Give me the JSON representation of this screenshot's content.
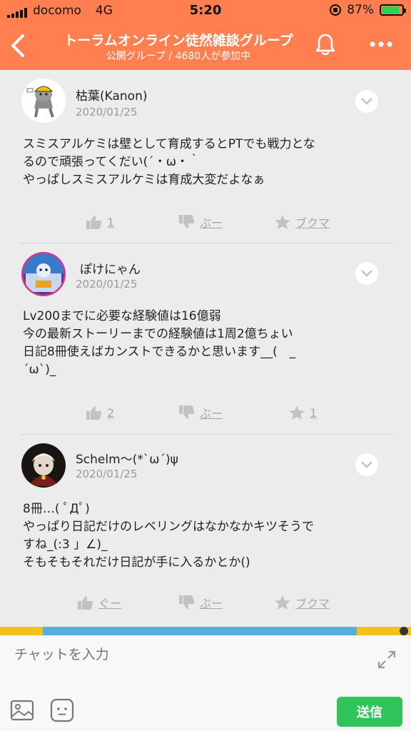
{
  "status_bar": {
    "carrier": "docomo",
    "network": "4G",
    "time": "5:20",
    "battery": "87%",
    "battery_level": 0.87
  },
  "header": {
    "title": "トーラムオンライン徒然雑談グループ",
    "subtitle": "公開グループ / 4680人が参加中"
  },
  "posts": [
    {
      "author": "枯葉(Kanon)",
      "date": "2020/01/25",
      "lines": [
        "スミスアルケミは壁として育成するとPTでも戦力とな",
        "るので頑張ってくだい(´・ω・｀",
        "やっぱしスミスアルケミは育成大変だよなぁ"
      ],
      "like": "1",
      "dislike": "ぶー",
      "bookmark": "ブクマ"
    },
    {
      "author": "ぽけにゃん",
      "date": "2020/01/25",
      "lines": [
        "Lv200までに必要な経験値は16億弱",
        "今の最新ストーリーまでの経験値は1周2億ちょい",
        "日記8冊使えばカンストできるかと思います__(　_",
        "´ω`)_"
      ],
      "like": "2",
      "dislike": "ぶー",
      "bookmark": "1"
    },
    {
      "author": "Schelm〜(*`ω´)ψ",
      "date": "2020/01/25",
      "lines": [
        "8冊…( ﾟДﾟ)",
        "やっぱり日記だけのレベリングはなかなかキツそうで",
        "すね_(:3 」∠)_",
        "そもそもそれだけ日記が手に入るかとか()"
      ],
      "like": "ぐー",
      "dislike": "ぶー",
      "bookmark": "ブクマ"
    }
  ],
  "composer": {
    "placeholder": "チャットを入力",
    "send_label": "送信"
  },
  "colors": {
    "header": "#ff7f50",
    "send": "#31c45a",
    "battery": "#2bd24b"
  },
  "icons": [
    "back-icon",
    "bell-icon",
    "more-icon",
    "chevron-down-icon",
    "thumbs-up-icon",
    "thumbs-down-icon",
    "star-icon",
    "expand-icon",
    "image-icon",
    "sticker-icon"
  ]
}
